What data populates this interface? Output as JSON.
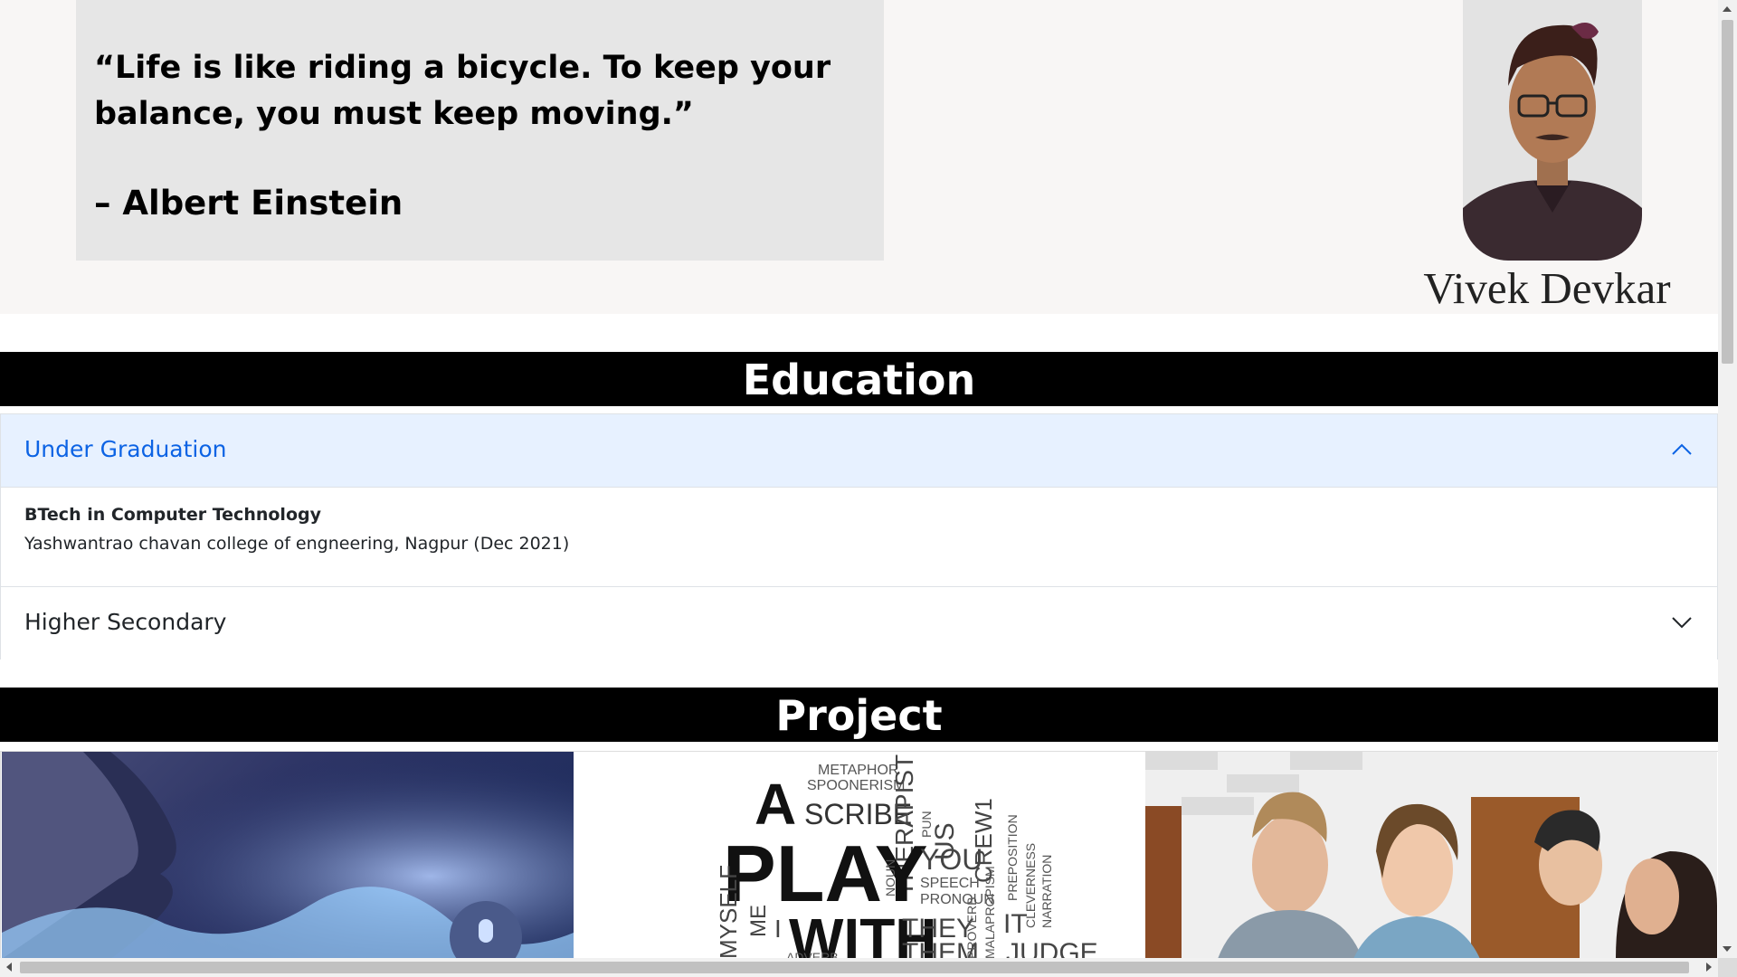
{
  "hero": {
    "quote": "“Life is like riding a bicycle. To keep your balance, you must keep moving.”",
    "author": "– Albert Einstein",
    "name": "Vivek Devkar"
  },
  "education": {
    "title": "Education",
    "items": [
      {
        "label": "Under Graduation",
        "expanded": true,
        "degree": "BTech in Computer Technology",
        "college": "Yashwantrao chavan college of engneering, Nagpur (Dec 2021)"
      },
      {
        "label": "Higher Secondary",
        "expanded": false
      }
    ]
  },
  "project": {
    "title": "Project",
    "images": [
      {
        "icon": "voice-assistant-image"
      },
      {
        "icon": "word-cloud-image",
        "words": [
          "METAPHOR",
          "SPOONERISM",
          "A",
          "SCRIBE",
          "THERAPIST",
          "PUN",
          "US",
          "CREW1",
          "PLAY",
          "NOUN",
          "SPEECH",
          "PRONOUN",
          "YOU",
          "PREPOSITION",
          "MYSELF",
          "ME",
          "I",
          "WITH",
          "THEY",
          "THEM",
          "PROVERB",
          "MALAPROPISM",
          "IT",
          "CLEVERNESS",
          "NARRATION",
          "JUDGE",
          "ADVERB"
        ]
      },
      {
        "icon": "students-photo-image"
      }
    ]
  },
  "colors": {
    "accordion_active_bg": "#e7f1ff",
    "accordion_active_text": "#0c63e4",
    "section_bar": "#000000"
  }
}
